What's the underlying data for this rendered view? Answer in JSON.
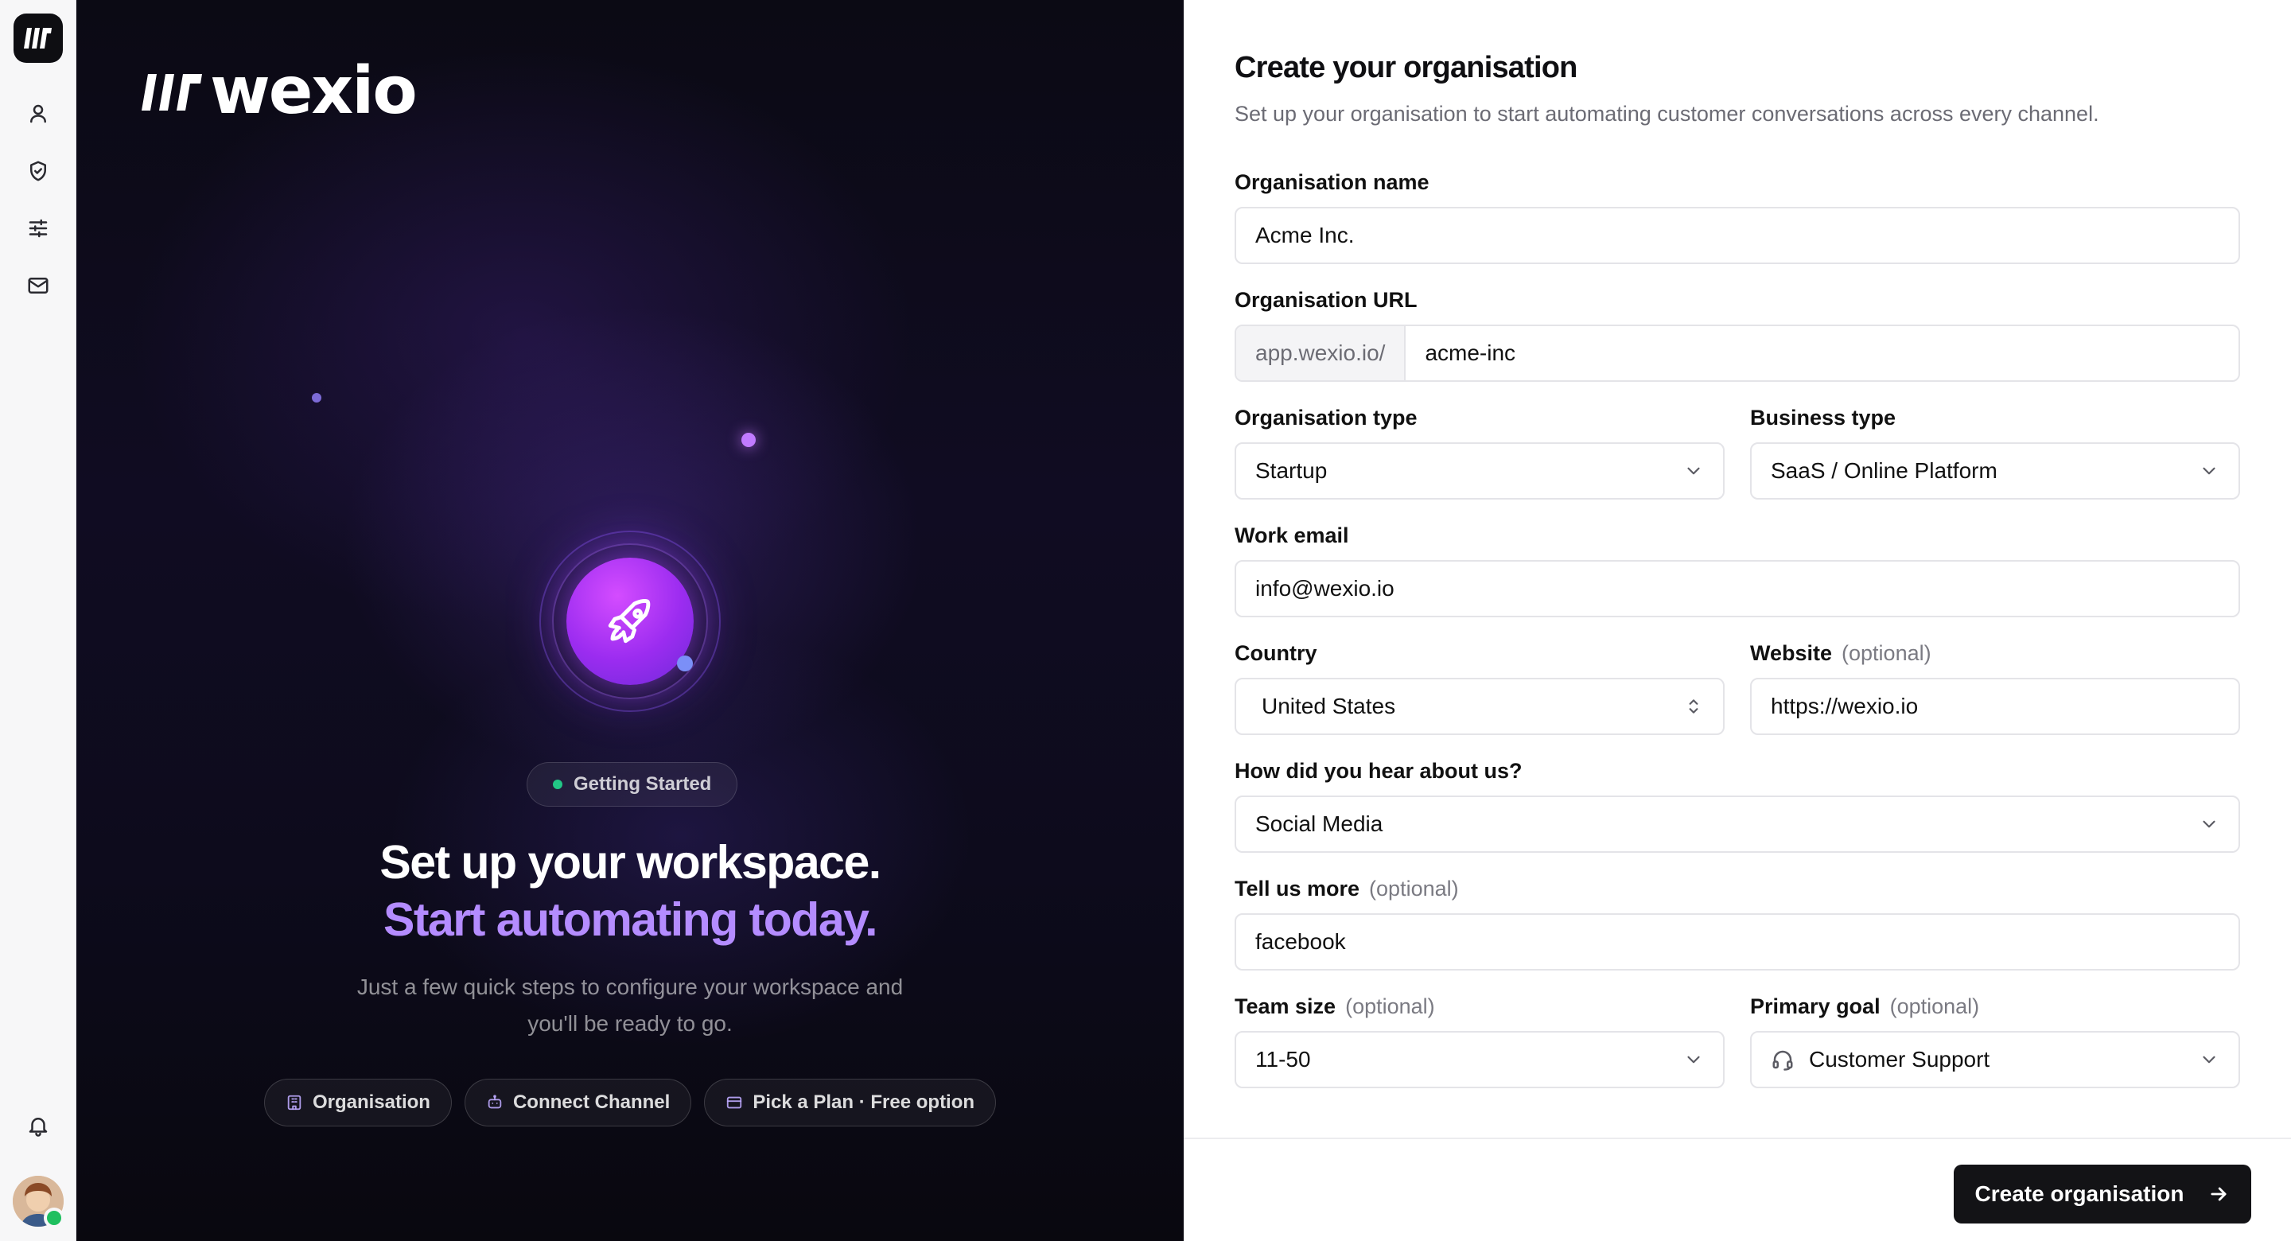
{
  "brand": {
    "name": "wexio"
  },
  "rail": {
    "items": [
      {
        "name": "user-icon",
        "label": "Profile"
      },
      {
        "name": "shield-icon",
        "label": "Security"
      },
      {
        "name": "sliders-icon",
        "label": "Settings"
      },
      {
        "name": "mail-icon",
        "label": "Inbox"
      }
    ],
    "bottom": [
      {
        "name": "bell-icon",
        "label": "Notifications"
      }
    ],
    "status_color": "#1fbf5f"
  },
  "hero": {
    "badge": "Getting Started",
    "headline_1": "Set up your workspace.",
    "headline_2": "Start automating today.",
    "subtitle_1": "Just a few quick steps to configure your workspace and",
    "subtitle_2": "you'll be ready to go.",
    "steps": [
      {
        "icon": "building-icon",
        "label": "Organisation"
      },
      {
        "icon": "robot-icon",
        "label": "Connect Channel"
      },
      {
        "icon": "card-icon",
        "label": "Pick a Plan · Free option"
      }
    ],
    "accent": "#b48cff"
  },
  "form": {
    "title": "Create your organisation",
    "description": "Set up your organisation to start automating customer conversations across every channel.",
    "org_name": {
      "label": "Organisation name",
      "value": "Acme Inc."
    },
    "org_url": {
      "label": "Organisation URL",
      "prefix": "app.wexio.io/",
      "value": "acme-inc"
    },
    "org_type": {
      "label": "Organisation type",
      "value": "Startup"
    },
    "business_type": {
      "label": "Business type",
      "value": "SaaS / Online Platform"
    },
    "work_email": {
      "label": "Work email",
      "value": "info@wexio.io"
    },
    "country": {
      "label": "Country",
      "value": "United States"
    },
    "website": {
      "label": "Website",
      "optional": "(optional)",
      "value": "https://wexio.io"
    },
    "hear_about": {
      "label": "How did you hear about us?",
      "value": "Social Media"
    },
    "tell_more": {
      "label": "Tell us more",
      "optional": "(optional)",
      "value": "facebook"
    },
    "team_size": {
      "label": "Team size",
      "optional": "(optional)",
      "value": "11-50"
    },
    "primary_goal": {
      "label": "Primary goal",
      "optional": "(optional)",
      "value": "Customer Support",
      "icon": "headset-icon"
    },
    "submit_label": "Create organisation"
  }
}
